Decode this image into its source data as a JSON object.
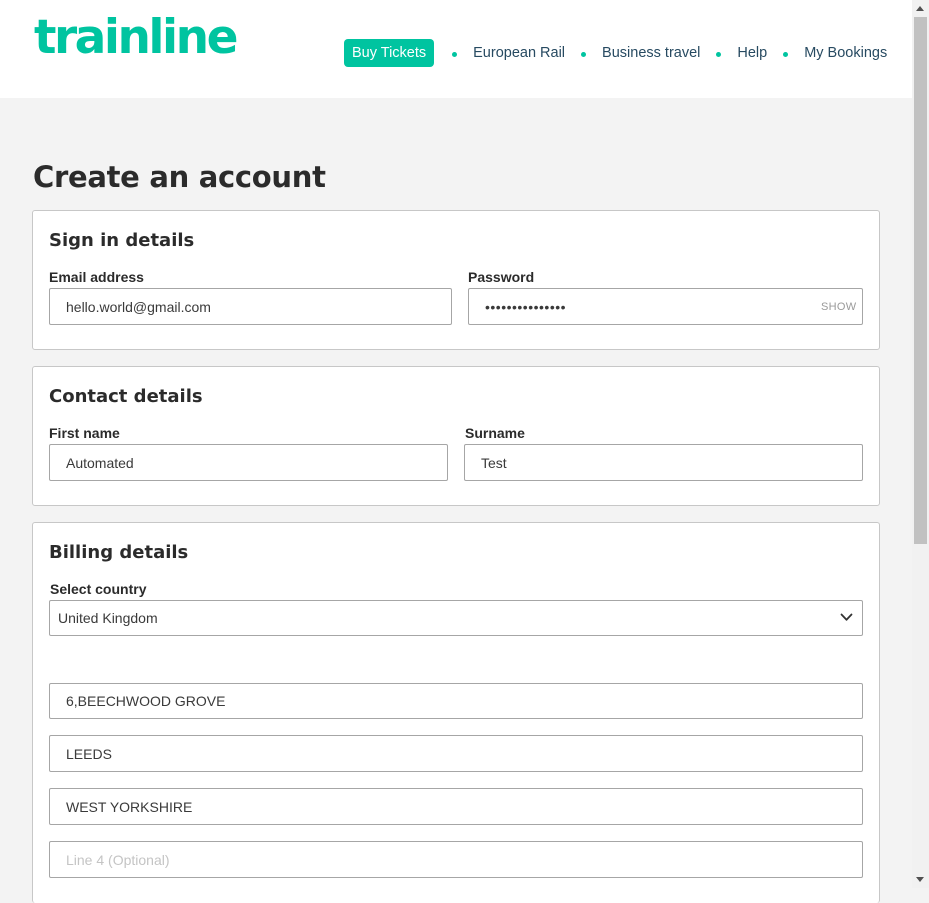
{
  "header": {
    "logo_text": "trainline",
    "nav": {
      "buy_tickets": "Buy Tickets",
      "european_rail": "European Rail",
      "business_travel": "Business travel",
      "help": "Help",
      "my_bookings": "My Bookings"
    }
  },
  "page_title": "Create an account",
  "sign_in": {
    "heading": "Sign in details",
    "email_label": "Email address",
    "email_value": "hello.world@gmail.com",
    "password_label": "Password",
    "password_value": "•••••••••••••••",
    "show_label": "SHOW"
  },
  "contact": {
    "heading": "Contact details",
    "first_name_label": "First name",
    "first_name_value": "Automated",
    "surname_label": "Surname",
    "surname_value": "Test"
  },
  "billing": {
    "heading": "Billing details",
    "country_label": "Select country",
    "country_value": "United Kingdom",
    "line1_value": "6,BEECHWOOD GROVE",
    "line2_value": "LEEDS",
    "line3_value": "WEST YORKSHIRE",
    "line4_placeholder": "Line 4 (Optional)"
  },
  "colors": {
    "brand": "#00c4a0",
    "nav_text": "#274a61",
    "page_bg": "#f3f3f3"
  }
}
